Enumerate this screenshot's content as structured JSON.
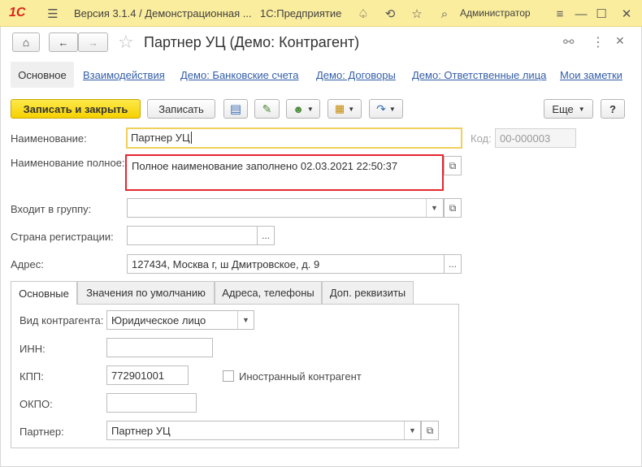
{
  "app": {
    "logo": "1С",
    "title": "Версия 3.1.4 / Демонстрационная ...",
    "product": "1С:Предприятие",
    "user": "Администратор"
  },
  "document": {
    "title": "Партнер УЦ (Демо: Контрагент)"
  },
  "nav_tabs": [
    {
      "label": "Основное",
      "active": true
    },
    {
      "label": "Взаимодействия"
    },
    {
      "label": "Демо: Банковские счета"
    },
    {
      "label": "Демо: Договоры"
    },
    {
      "label": "Демо: Ответственные лица"
    },
    {
      "label": "Мои заметки"
    }
  ],
  "toolbar": {
    "save_close": "Записать и закрыть",
    "save": "Записать",
    "more": "Еще",
    "help": "?"
  },
  "form": {
    "name_label": "Наименование:",
    "name_value": "Партнер УЦ",
    "code_label": "Код:",
    "code_value": "00-000003",
    "fullname_label": "Наименование полное:",
    "fullname_value": "Полное наименование заполнено 02.03.2021 22:50:37",
    "group_label": "Входит в группу:",
    "group_value": "",
    "country_label": "Страна регистрации:",
    "country_value": "",
    "address_label": "Адрес:",
    "address_value": "127434, Москва г, ш Дмитровское, д. 9"
  },
  "inner_tabs": [
    {
      "label": "Основные",
      "active": true
    },
    {
      "label": "Значения по умолчанию"
    },
    {
      "label": "Адреса, телефоны"
    },
    {
      "label": "Доп. реквизиты"
    }
  ],
  "main_tab": {
    "kind_label": "Вид контрагента:",
    "kind_value": "Юридическое лицо",
    "inn_label": "ИНН:",
    "inn_value": "",
    "kpp_label": "КПП:",
    "kpp_value": "772901001",
    "foreign_label": "Иностранный контрагент",
    "foreign_checked": false,
    "okpo_label": "ОКПО:",
    "okpo_value": "",
    "partner_label": "Партнер:",
    "partner_value": "Партнер УЦ"
  },
  "colors": {
    "titlebar": "#fbed9e",
    "primary_button": "#f5d100",
    "link": "#335ea8",
    "highlight_border": "#e5262e",
    "focus_border": "#f0cf5a"
  }
}
